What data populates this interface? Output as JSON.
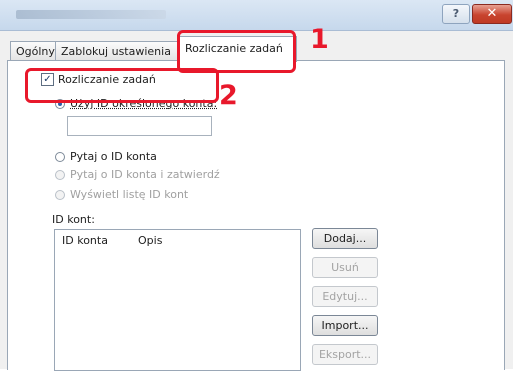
{
  "window": {
    "help_label": "?",
    "close_label": "✕"
  },
  "tabs": [
    {
      "label": "Ogólny"
    },
    {
      "label": "Zablokuj ustawienia"
    },
    {
      "label": "Rozliczanie zadań"
    }
  ],
  "callouts": [
    "1",
    "2"
  ],
  "job_accounting": {
    "checkbox_label": "Rozliczanie zadań",
    "checkbox_mark": "✓",
    "radio_use_specific_id": "Użyj ID określonego konta:",
    "account_id_value": "",
    "radio_prompt_id": "Pytaj o ID konta",
    "radio_prompt_validate": "Pytaj o ID konta i zatwierdź",
    "radio_show_list": "Wyświetl listę ID kont"
  },
  "id_list": {
    "label": "ID kont:",
    "columns": [
      "ID konta",
      "Opis"
    ],
    "rows": []
  },
  "buttons": {
    "add": "Dodaj...",
    "remove": "Usuń",
    "edit": "Edytuj...",
    "import": "Import...",
    "export": "Eksport..."
  },
  "colors": {
    "callout_red": "#e8182b"
  }
}
